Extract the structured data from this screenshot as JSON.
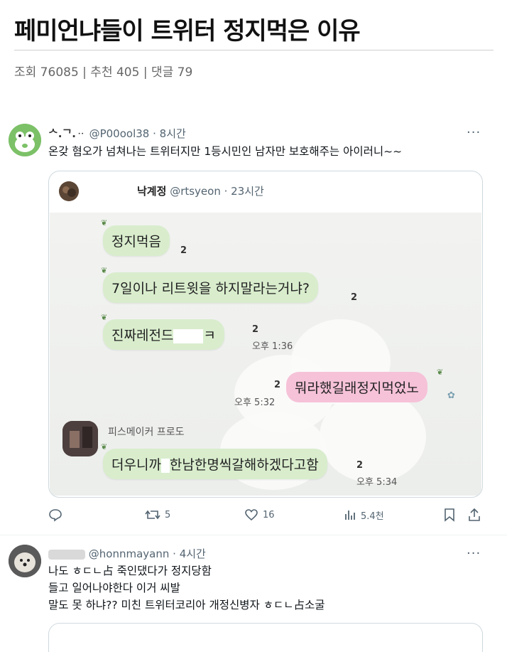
{
  "post": {
    "title": "페미언냐들이 트위터 정지먹은 이유",
    "meta": "조회 76085 | 추천 405 | 댓글 79"
  },
  "tweet1": {
    "display_name": "ᄉ.ᄀ.ᆢ",
    "handle": "@P00ool38",
    "time": "· 8시간",
    "more": "···",
    "text": "온갖 혐오가 넘쳐나는 트위터지만 1등시민인 남자만 보호해주는 아이러니~~",
    "quote": {
      "display_name": "낙계정",
      "handle": "@rtsyeon · 23시간",
      "chat": {
        "messages": [
          {
            "text": "정지먹음",
            "count": "2"
          },
          {
            "text": "7일이나 리트윗을 하지말라는거냐?",
            "count": "2"
          },
          {
            "text_before": "진짜레전드",
            "text_after": "ㅋ",
            "count": "2",
            "time": "오후 1:36"
          },
          {
            "text": "뭐라했길래정지먹었노",
            "count": "2",
            "time": "오후 5:32"
          },
          {
            "sender": "피스메이커 프로도",
            "text_before": "더우니까",
            "text_after": "한남한명씩갈해하겠다고함",
            "count": "2",
            "time": "오후 5:34"
          }
        ]
      }
    },
    "actions": {
      "reply": "",
      "retweets": "5",
      "likes": "16",
      "views": "5.4천"
    }
  },
  "tweet2": {
    "handle": "@honnmayann",
    "time": "· 4시간",
    "more": "···",
    "line1": "나도 ㅎㄷㄴ占 죽인댔다가 정지당함",
    "line2": "들고 일어나야한다 이거 씨발",
    "line3": "말도 못 하냐?? 미친 트위터코리아 개정신병자 ㅎㄷㄴ占소굴"
  },
  "icons": {
    "reply": "reply-icon",
    "retweet": "retweet-icon",
    "like": "heart-icon",
    "views": "views-icon",
    "bookmark": "bookmark-icon",
    "share": "share-icon"
  }
}
